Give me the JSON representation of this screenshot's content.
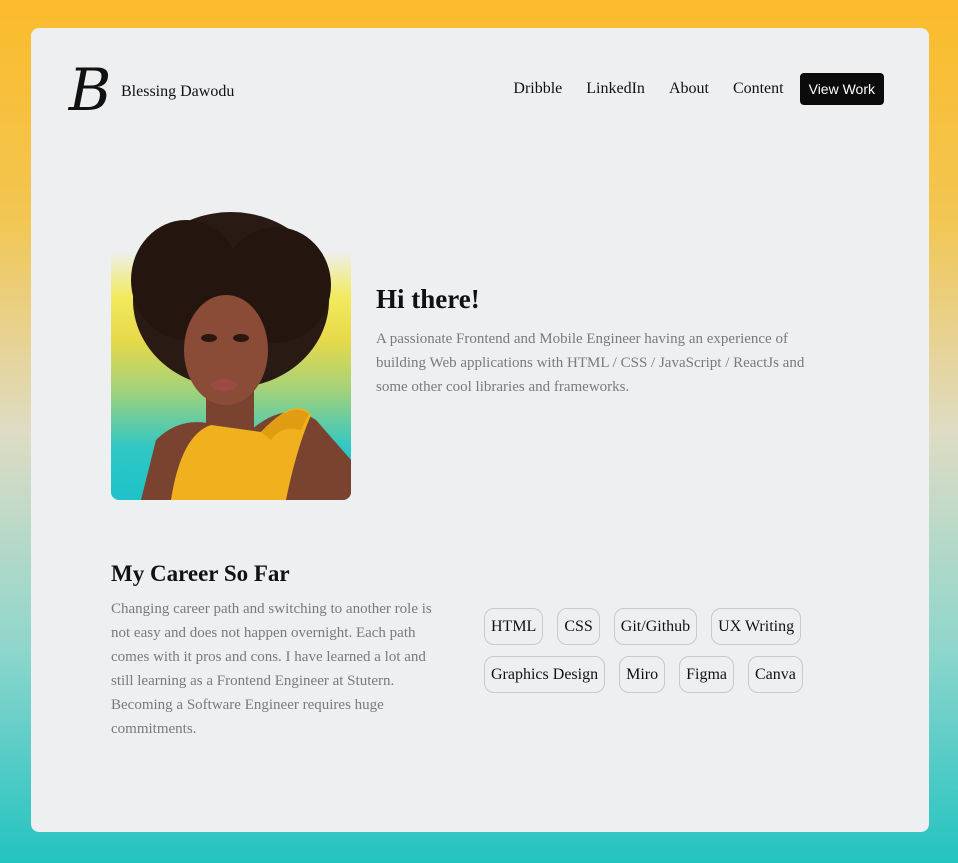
{
  "brand": {
    "initial": "B",
    "name": "Blessing Dawodu"
  },
  "nav": {
    "links": [
      "Dribble",
      "LinkedIn",
      "About",
      "Content"
    ],
    "cta": "View Work"
  },
  "hero": {
    "title": "Hi there!",
    "description": "A passionate Frontend and Mobile Engineer having an experience of building Web applications with HTML / CSS / JavaScript / ReactJs and some other cool libraries and frameworks."
  },
  "career": {
    "title": "My Career So Far",
    "description": "Changing career path and switching to another role is not easy and does not happen overnight. Each path comes with it pros and cons. I have learned a lot and still learning as a Frontend Engineer at Stutern. Becoming a Software Engineer requires huge commitments."
  },
  "skills": [
    "HTML",
    "CSS",
    "Git/Github",
    "UX Writing",
    "Graphics Design",
    "Miro",
    "Figma",
    "Canva"
  ],
  "colors": {
    "gradient_top": "#fbbb2c",
    "gradient_bottom": "#22c3c1",
    "card": "#eeeff1",
    "cta_bg": "#0b0b0b"
  }
}
